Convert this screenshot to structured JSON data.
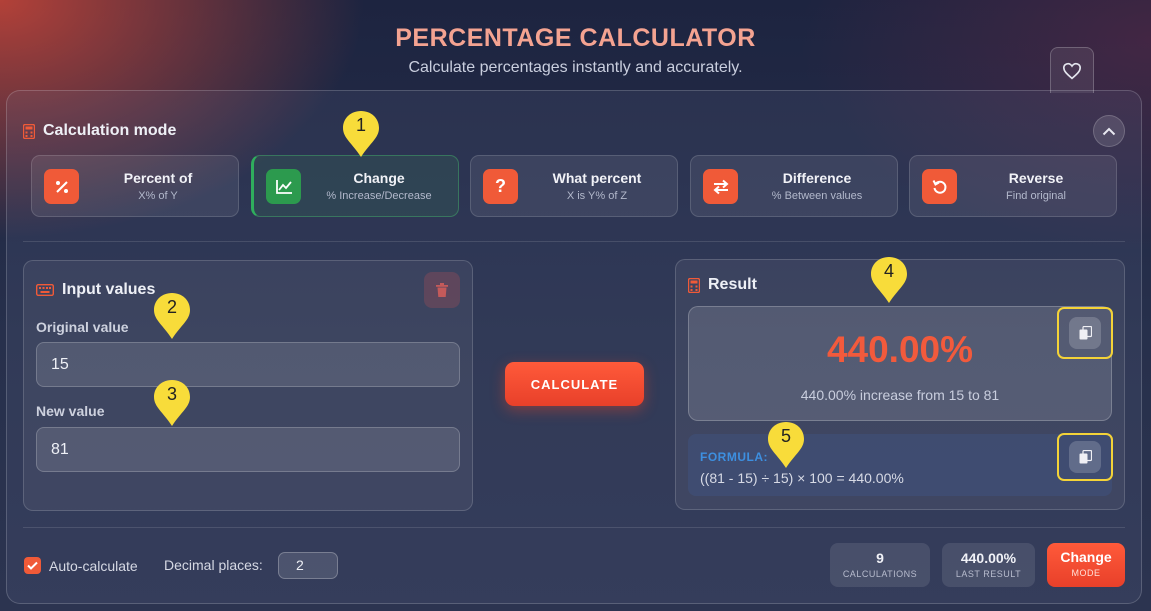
{
  "header": {
    "title": "PERCENTAGE CALCULATOR",
    "subtitle": "Calculate percentages instantly and accurately."
  },
  "mode_section": {
    "title": "Calculation mode"
  },
  "modes": [
    {
      "name": "Percent of",
      "desc": "X% of Y",
      "icon": "percent-icon",
      "active": false
    },
    {
      "name": "Change",
      "desc": "% Increase/Decrease",
      "icon": "chart-line-icon",
      "active": true
    },
    {
      "name": "What percent",
      "desc": "X is Y% of Z",
      "icon": "question-icon",
      "active": false
    },
    {
      "name": "Difference",
      "desc": "% Between values",
      "icon": "swap-arrows-icon",
      "active": false
    },
    {
      "name": "Reverse",
      "desc": "Find original",
      "icon": "undo-icon",
      "active": false
    }
  ],
  "inputs": {
    "title": "Input values",
    "original_label": "Original value",
    "original_value": "15",
    "new_label": "New value",
    "new_value": "81"
  },
  "calculate_label": "CALCULATE",
  "result": {
    "title": "Result",
    "value": "440.00%",
    "description": "440.00% increase from 15 to 81",
    "formula_label": "FORMULA:",
    "formula": "((81 - 15) ÷ 15) × 100 = 440.00%"
  },
  "footer": {
    "auto_calc_label": "Auto-calculate",
    "auto_calc_checked": true,
    "decimal_label": "Decimal places:",
    "decimal_value": "2",
    "stats": [
      {
        "value": "9",
        "label": "CALCULATIONS"
      },
      {
        "value": "440.00%",
        "label": "LAST RESULT"
      }
    ],
    "change_mode": {
      "top": "Change",
      "bottom": "MODE"
    }
  },
  "annotations": [
    "1",
    "2",
    "3",
    "4",
    "5"
  ],
  "colors": {
    "accent": "#f05a38",
    "active": "#2c9a4e",
    "highlight": "#f4d338",
    "formula": "#3d8fe0"
  }
}
